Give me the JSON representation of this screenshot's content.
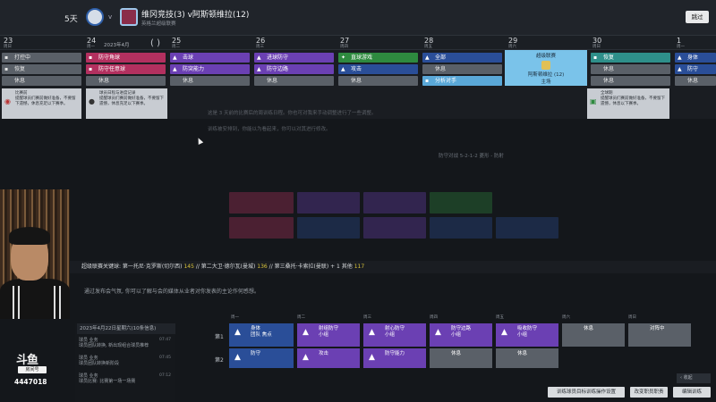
{
  "header": {
    "days_label": "5天",
    "match_title": "维冈竞技(3) v阿斯顿维拉(12)",
    "match_subtitle": "英格兰超级联赛",
    "vs": "v",
    "skip_button": "跳过"
  },
  "calendar": {
    "month": "2023年4月",
    "days": [
      {
        "num": "23",
        "name": "周日"
      },
      {
        "num": "24",
        "name": "周一"
      },
      {
        "num": "25",
        "name": "周二"
      },
      {
        "num": "26",
        "name": "周三"
      },
      {
        "num": "27",
        "name": "周四"
      },
      {
        "num": "28",
        "name": "周五"
      },
      {
        "num": "29",
        "name": "周六"
      },
      {
        "num": "30",
        "name": "周日"
      },
      {
        "num": "1",
        "name": "周一"
      }
    ],
    "sessions": {
      "d0": [
        "打控中",
        "恢复",
        "休息"
      ],
      "d1": [
        "防守角球",
        "防守任意球",
        "休息"
      ],
      "d2": [
        "击球",
        "防突能力",
        "休息"
      ],
      "d3": [
        "进球防守",
        "防守边路",
        "休息"
      ],
      "d4": [
        "直球游戏",
        "攻击",
        "休息"
      ],
      "d5": [
        "全部",
        "休息",
        "分析对手"
      ],
      "d7": [
        "恢复",
        "休息",
        "休息"
      ],
      "d8": [
        "身体",
        "防守",
        "休息"
      ]
    },
    "fixture": {
      "competition": "超级联赛",
      "opponent": "阿斯顿维拉 (12)",
      "venue": "主场"
    }
  },
  "info_cards": [
    {
      "title": "比赛前",
      "text": "提醒球员们赛前做好准备，不要留下遗憾，休息充足以下赛季。"
    },
    {
      "title": "球员日程与进度记录",
      "text": "提醒球员们赛前做好准备，不要留下遗憾，休息充足以下赛季。"
    },
    {
      "title": "全球期",
      "text": "提醒球员们赛前做好准备，不要留下遗憾，休息以下赛季。"
    }
  ],
  "background": {
    "line1": "这是 3 天前的比赛后的周训练日程。你也可对我来手动调整进行了一些调整。",
    "line2": "训练被安排到，你能以为看起来，你可以对其进行修改。",
    "scheme": "防守对战 5-2-1-2 菱形 - 防射",
    "weeks": [
      "周一",
      "周二",
      "周三",
      "周四",
      "周五",
      "周六",
      "周日"
    ]
  },
  "ticker": {
    "prefix": "超级联赛关键球: 第一托尼·克罗斯(切尔西)",
    "v1": "145",
    "mid": "// 第二大卫·德尔瓦(曼城)",
    "v2": "136",
    "mid2": "// 第三桑托·卡索拉(曼联) + 1 其他",
    "v3": "117"
  },
  "press": {
    "text": "通过发布会气氛, 你可以了解与会的媒体从业者对你发表的主论作何感想。"
  },
  "lower": {
    "weeks": [
      "周一",
      "周二",
      "周三",
      "周四",
      "周五",
      "周六",
      "周日"
    ],
    "row1_label": "第1",
    "row2_label": "第2",
    "row1": [
      {
        "label": "身体",
        "sub": "团队 焦点"
      },
      {
        "label": "射组防守",
        "sub": "小组"
      },
      {
        "label": "射心防守",
        "sub": "小组"
      },
      {
        "label": "防守边路",
        "sub": "小组"
      },
      {
        "label": "吸收防守",
        "sub": "小组"
      },
      {
        "label": "休息",
        "sub": ""
      },
      {
        "label": "对阵中",
        "sub": ""
      }
    ],
    "row2": [
      {
        "label": "防守"
      },
      {
        "label": "攻击"
      },
      {
        "label": "防守能力"
      },
      {
        "label": "休息"
      },
      {
        "label": "休息"
      }
    ]
  },
  "news": {
    "header": "2023年4月22日星期六(10条信息)",
    "items": [
      {
        "title": "球员 业务",
        "text": "球员团队转换, 新出现组合球员推荐",
        "time": "07:47"
      },
      {
        "title": "球员 业务",
        "text": "球员团队转换新阶段",
        "time": "07:45"
      },
      {
        "title": "球员 业务",
        "text": "球员比赛: 比赛第一场一场赛",
        "time": "07:12"
      }
    ]
  },
  "stream": {
    "logo": "斗鱼",
    "logo_sub": "房间号",
    "room_id": "4447018"
  },
  "buttons": {
    "collapse": "收起",
    "b1": "训练球员目标训练操作设置",
    "b2": "改变职员职责",
    "b3": "编辑训练"
  },
  "colors": {
    "pink": "#b3305f",
    "purple": "#6b40b3",
    "green": "#2e8a3f",
    "blue": "#2a4e98",
    "teal": "#2e8f8a",
    "gray": "#5a6068",
    "fixture": "#7ac3ea"
  }
}
